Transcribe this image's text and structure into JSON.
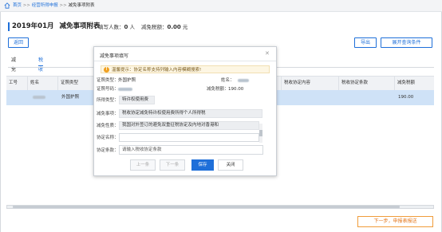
{
  "breadcrumb": {
    "home": "首页",
    "sep1": ">>",
    "item1": "经营所得申报",
    "sep2": ">>",
    "current": "减免事项附表"
  },
  "header": {
    "period": "2019年01月",
    "title": "减免事项附表",
    "filled_label": "填写人数：",
    "filled_count": "0",
    "filled_unit": "人",
    "tax_label": "减免税额：",
    "tax_value": "0.00",
    "tax_unit": "元"
  },
  "toolbar": {
    "back": "返回",
    "export": "导出",
    "expand": "展开查询条件"
  },
  "tabs": [
    {
      "label": "减免税额",
      "active": false
    },
    {
      "label": "税收协定",
      "active": true
    }
  ],
  "table": {
    "columns": [
      "工号",
      "姓名",
      "证照类型",
      "税收协定内容",
      "税收协定条款",
      "减免税额"
    ],
    "rows": [
      {
        "id": "",
        "name": "",
        "id_type": "外国护照",
        "content": "",
        "clause": "",
        "amount": "190.00"
      }
    ]
  },
  "footer": {
    "next": "下一步，申报表报送"
  },
  "modal": {
    "title": "减免事项填写",
    "warning": "温馨提示：协定名称支持列输入内容模糊搜索!",
    "id_type_label": "证照类型：",
    "id_type_value": "外国护照",
    "name_label": "姓名：",
    "id_no_label": "证照号码：",
    "tax_label": "减免税额：",
    "tax_value": "190.00",
    "income_label": "所得类型：",
    "income_value": "特许权使用费",
    "item_label": "减免事项：",
    "item_value": "税收协定减免特许权使用费所得个人所得税",
    "nature_label": "减免性质：",
    "nature_value": "我国对外签订的避免双重征税协定及内地对香港和",
    "agreement_label": "协定名称：",
    "agreement_value": "",
    "clause_label": "协定条款：",
    "clause_placeholder": "请输入税收协定条款",
    "buttons": {
      "prev": "上一条",
      "next": "下一条",
      "save": "保存",
      "close": "关闭"
    }
  },
  "colors": {
    "accent": "#1e6fd9",
    "warn": "#f0a020",
    "next_button": "#e3761a",
    "row_highlight": "#cfe2f7"
  }
}
